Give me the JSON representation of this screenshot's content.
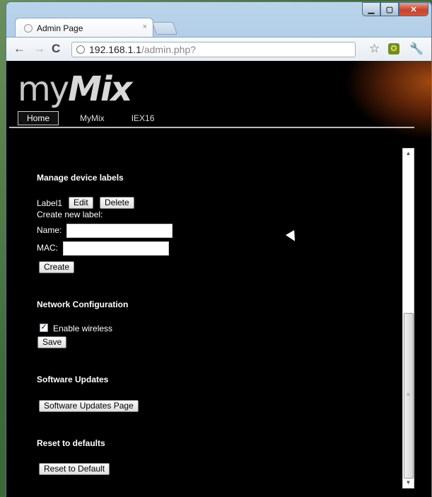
{
  "browser": {
    "tab_title": "Admin Page",
    "tab_close": "×",
    "url_host": "192.168.1.1",
    "url_path": "/admin.php?",
    "back_icon": "back-arrow-icon",
    "forward_icon": "forward-arrow-icon",
    "reload_icon": "reload-icon"
  },
  "site": {
    "logo_my": "my",
    "logo_mix": "Mix",
    "nav": [
      "Home",
      "MyMix",
      "IEX16"
    ],
    "active_nav": "Home"
  },
  "labels_section": {
    "title": "Manage device labels",
    "existing_label": "Label1",
    "edit": "Edit",
    "delete": "Delete",
    "create_new": "Create new label:",
    "name_label": "Name:",
    "name_value": "",
    "mac_label": "MAC:",
    "mac_value": "",
    "create": "Create"
  },
  "network_section": {
    "title": "Network Configuration",
    "enable_wireless": "Enable wireless",
    "enable_wireless_checked": true,
    "save": "Save"
  },
  "updates_section": {
    "title": "Software Updates",
    "button": "Software Updates Page"
  },
  "reset_section": {
    "title": "Reset to defaults",
    "button": "Reset to Default"
  },
  "colors": {
    "page_bg": "#000000",
    "accent_glow": "#a04a10"
  }
}
